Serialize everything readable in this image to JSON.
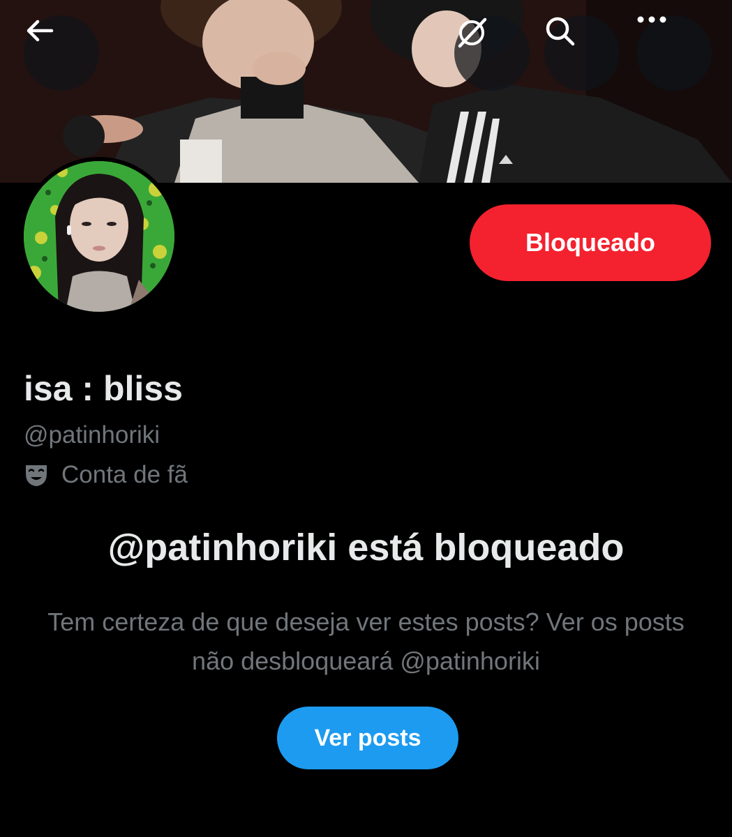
{
  "topbar": {
    "back_icon": "arrow-left-icon",
    "grok_icon": "grok-icon",
    "search_icon": "search-icon",
    "more_icon": "more-dots-icon"
  },
  "profile": {
    "display_name": "isa : bliss",
    "handle": "@patinhoriki",
    "category_icon": "theater-mask-icon",
    "category": "Conta de fã",
    "blocked_button_label": "Bloqueado"
  },
  "blocked_notice": {
    "title": "@patinhoriki está bloqueado",
    "description": "Tem certeza de que deseja ver estes posts? Ver os posts não desbloqueará @patinhoriki",
    "view_button_label": "Ver posts"
  },
  "colors": {
    "background": "#000000",
    "blocked_red": "#f4212e",
    "accent_blue": "#1d9bf0",
    "muted_text": "#71767b",
    "primary_text": "#e7e9ea"
  }
}
